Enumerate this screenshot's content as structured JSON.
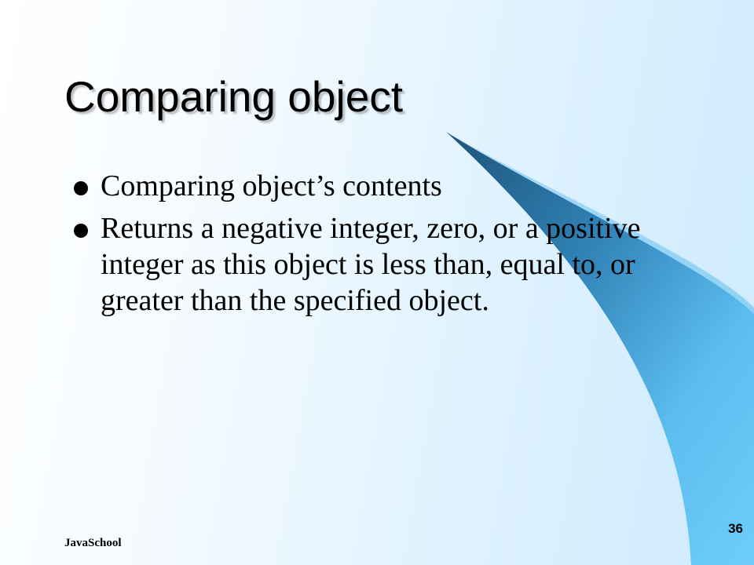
{
  "slide": {
    "title": "Comparing object",
    "bullets": [
      "Comparing object’s contents",
      "Returns a negative integer, zero, or a positive integer as this object is less than, equal to, or greater than the specified object."
    ],
    "footer_label": "JavaSchool",
    "page_number": "36"
  },
  "colors": {
    "background_light": "#ffffff",
    "background_tint": "#cdeafd",
    "swoosh_light": "#6fcaf8",
    "swoosh_dark": "#2d6e98"
  }
}
